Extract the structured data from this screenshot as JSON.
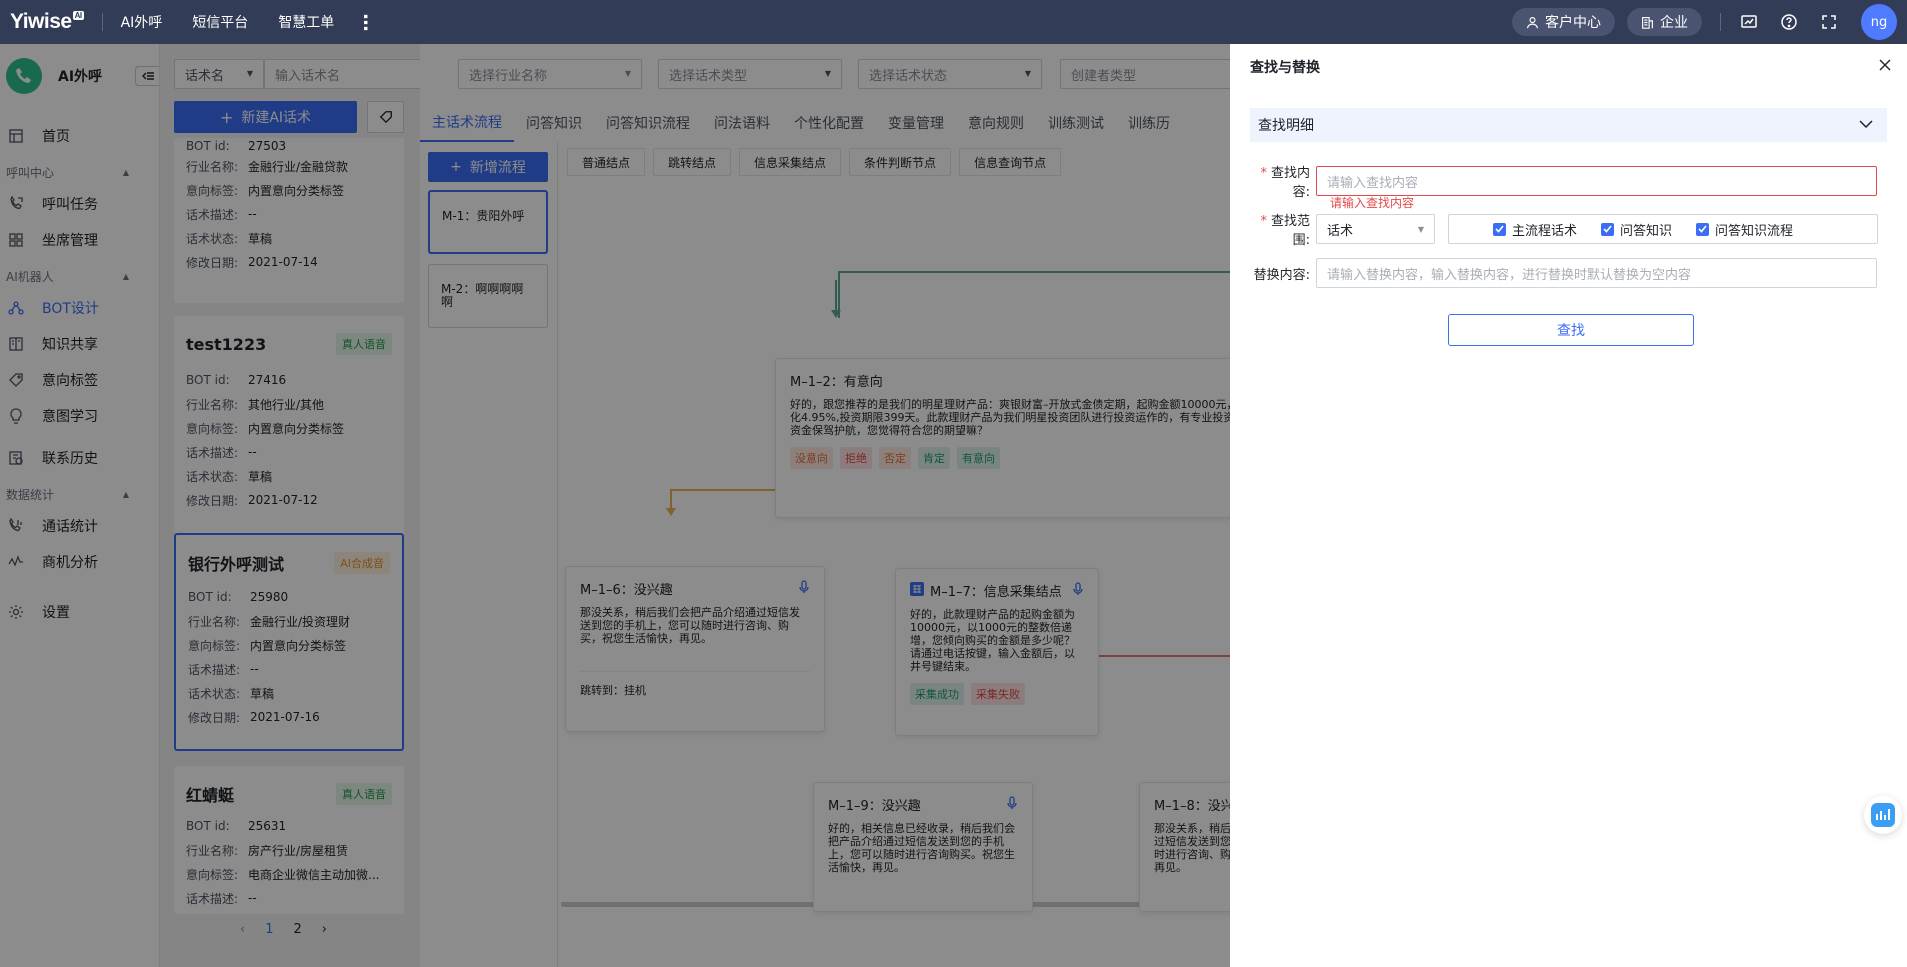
{
  "topbar": {
    "logo": "Yiwise",
    "logo_badge": "AI",
    "nav": [
      "AI外呼",
      "短信平台",
      "智慧工单"
    ],
    "customer_center": "客户中心",
    "enterprise": "企业",
    "avatar": "ng"
  },
  "sidebar": {
    "brand": "AI外呼",
    "items": [
      {
        "label": "首页",
        "icon": "home-icon"
      },
      {
        "group": "呼叫中心"
      },
      {
        "label": "呼叫任务",
        "icon": "phone-icon"
      },
      {
        "label": "坐席管理",
        "icon": "grid-icon"
      },
      {
        "group": "AI机器人"
      },
      {
        "label": "BOT设计",
        "icon": "flow-icon",
        "active": true
      },
      {
        "label": "知识共享",
        "icon": "book-icon"
      },
      {
        "label": "意向标签",
        "icon": "tag-icon"
      },
      {
        "label": "意图学习",
        "icon": "bulb-icon"
      },
      {
        "label": "联系历史",
        "icon": "history-icon"
      },
      {
        "group": "数据统计"
      },
      {
        "label": "通话统计",
        "icon": "call-stats-icon"
      },
      {
        "label": "商机分析",
        "icon": "chart-icon"
      },
      {
        "label": "设置",
        "icon": "gear-icon"
      }
    ]
  },
  "list": {
    "filter_type": "话术名",
    "search_placeholder": "输入话术名",
    "new_button": "新建AI话术",
    "card0": {
      "bot_id_label": "BOT id:",
      "bot_id": "27503",
      "industry": "金融行业/金融贷款",
      "intent": "内置意向分类标签",
      "desc": "--",
      "status": "草稿",
      "date": "2021-07-14"
    },
    "cards": [
      {
        "name": "test1223",
        "tag": "真人语音",
        "bot_id": "27416",
        "industry": "其他行业/其他",
        "intent": "内置意向分类标签",
        "desc": "--",
        "status": "草稿",
        "date": "2021-07-12"
      },
      {
        "name": "银行外呼测试",
        "tag": "AI合成音",
        "bot_id": "25980",
        "industry": "金融行业/投资理财",
        "intent": "内置意向分类标签",
        "desc": "--",
        "status": "草稿",
        "date": "2021-07-16"
      },
      {
        "name": "红蜻蜓",
        "tag": "真人语音",
        "bot_id": "25631",
        "industry": "房产行业/房屋租赁",
        "intent": "电商企业微信主动加微...",
        "desc": "--"
      }
    ],
    "labels": {
      "bot_id": "BOT id:",
      "industry": "行业名称:",
      "intent": "意向标签:",
      "desc": "话术描述:",
      "status": "话术状态:",
      "date": "修改日期:"
    },
    "pages": [
      "1",
      "2"
    ]
  },
  "main": {
    "filters": [
      "选择行业名称",
      "选择话术类型",
      "选择话术状态",
      "创建者类型"
    ],
    "tabs": [
      "主话术流程",
      "问答知识",
      "问答知识流程",
      "问法语料",
      "个性化配置",
      "变量管理",
      "意向规则",
      "训练测试",
      "训练历"
    ],
    "new_flow": "新增流程",
    "flows": [
      "M-1：贵阳外呼",
      "M-2：啊啊啊啊啊"
    ],
    "node_buttons": [
      "普通结点",
      "跳转结点",
      "信息采集结点",
      "条件判断节点",
      "信息查询节点"
    ],
    "node_m12": {
      "title": "M–1–2：有意向",
      "body": "好的，跟您推荐的是我们的明星理财产品：爽银财富–开放式金债定期，起购金额10000元，预期年化4.95%,投资期限399天。此款理财产品为我们明星投资团队进行投资运作的，有专业投资人为您的资金保驾护航，您觉得符合您的期望嘛？",
      "chips": [
        "没意向",
        "拒绝",
        "否定",
        "肯定",
        "有意向"
      ]
    },
    "node_m16": {
      "title": "M–1–6：没兴趣",
      "body": "那没关系，稍后我们会把产品介绍通过短信发送到您的手机上，您可以随时进行咨询、购买，祝您生活愉快，再见。",
      "jump": "跳转到：挂机"
    },
    "node_m17": {
      "title": "M–1–7：信息采集结点",
      "body": "好的，此款理财产品的起购金额为10000元，以1000元的整数倍递增，您倾向购买的金额是多少呢？请通过电话按键，输入金额后，以井号键结束。",
      "chips": [
        "采集成功",
        "采集失败"
      ]
    },
    "node_m19": {
      "title": "M–1–9：没兴趣",
      "body": "好的，相关信息已经收录，稍后我们会把产品介绍通过短信发送到您的手机上，您可以随时进行咨询购买。祝您生活愉快，再见。"
    },
    "node_m18": {
      "title": "M–1–8：没兴",
      "body": "那没关系，稍后过短信发送到您时进行咨询、购再见。"
    }
  },
  "drawer": {
    "title": "查找与替换",
    "section": "查找明细",
    "find_label": "查找内容:",
    "find_placeholder": "请输入查找内容",
    "find_error": "请输入查找内容",
    "scope_label": "查找范围:",
    "scope_value": "话术",
    "scope_options": [
      "主流程话术",
      "问答知识",
      "问答知识流程"
    ],
    "replace_label": "替换内容:",
    "replace_placeholder": "请输入替换内容，输入替换内容，进行替换时默认替换为空内容",
    "find_button": "查找"
  },
  "colors": {
    "primary": "#3b6df5",
    "topbar": "#323c56",
    "error": "#e04949"
  }
}
